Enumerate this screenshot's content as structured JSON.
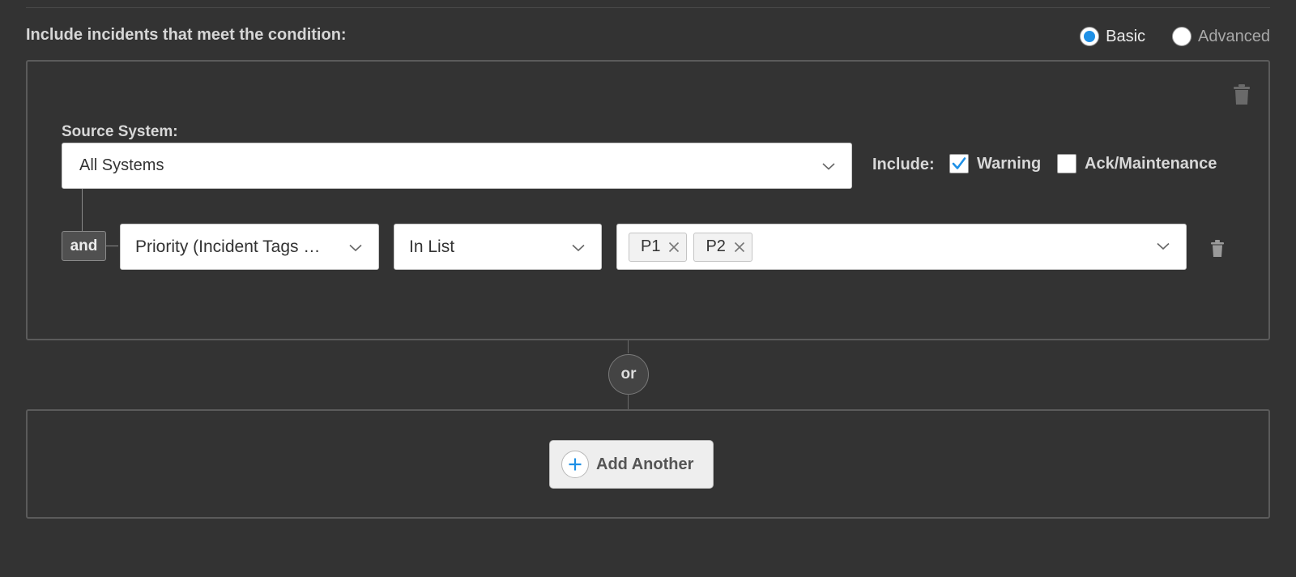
{
  "section": {
    "title": "Include incidents that meet the condition:",
    "mode_options": [
      {
        "label": "Basic",
        "selected": true
      },
      {
        "label": "Advanced",
        "selected": false
      }
    ]
  },
  "condition": {
    "source_label": "Source System:",
    "source_value": "All Systems",
    "include_label": "Include:",
    "include_options": [
      {
        "label": "Warning",
        "checked": true
      },
      {
        "label": "Ack/Maintenance",
        "checked": false
      }
    ],
    "rule": {
      "connector": "and",
      "field": "Priority (Incident Tags …",
      "operator": "In List",
      "values": [
        "P1",
        "P2"
      ]
    }
  },
  "or_label": "or",
  "add_another_label": "Add Another",
  "colors": {
    "background": "#333333",
    "accent": "#1e90e6",
    "panel_border": "#5b5b5b"
  },
  "icons": {
    "delete": "trash-icon",
    "dropdown": "chevron-down-icon",
    "remove_tag": "close-icon",
    "add": "plus-icon",
    "checked": "checkmark-icon"
  }
}
